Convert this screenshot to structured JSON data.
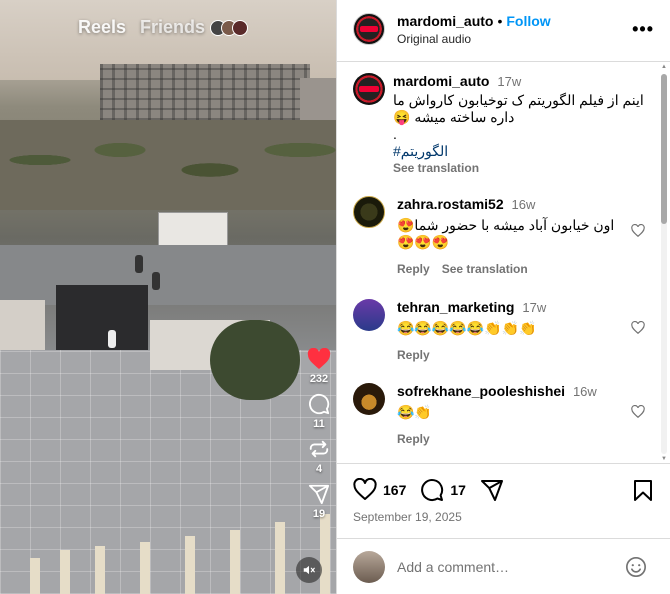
{
  "reel": {
    "tab_reels": "Reels",
    "tab_friends": "Friends",
    "likes_count": "232",
    "comments_count": "11",
    "reposts_count": "4",
    "shares_count": "19",
    "icons": [
      "heart-filled-icon",
      "comment-icon",
      "repost-icon",
      "share-icon",
      "mute-icon"
    ]
  },
  "post": {
    "username": "mardomi_auto",
    "separator": "•",
    "follow_label": "Follow",
    "audio": "Original audio",
    "caption": {
      "username": "mardomi_auto",
      "time": "17w",
      "text_line1": "اینم از فیلم الگوریتم ک توخیابون کارواش ما",
      "text_line2": "داره ساخته میشه 😝",
      "dot": ".",
      "hashtag": "#الگوریتم",
      "see_translation": "See translation"
    },
    "comments": [
      {
        "username": "zahra.rostami52",
        "time": "16w",
        "text": "اون خیابون آباد میشه با حضور شما😍",
        "text2": "😍😍😍",
        "reply": "Reply",
        "see_translation": "See translation"
      },
      {
        "username": "tehran_marketing",
        "time": "17w",
        "text": "😂😂😂😂😂👏👏👏",
        "reply": "Reply"
      },
      {
        "username": "sofrekhane_pooleshishei",
        "time": "16w",
        "text": "😂👏",
        "reply": "Reply"
      }
    ],
    "likes": "167",
    "comment_count": "17",
    "date": "September 19, 2025",
    "add_comment_placeholder": "Add a comment…"
  },
  "colors": {
    "accent": "#0095f6",
    "like_red": "#ff3040",
    "muted_text": "#737373",
    "border": "#dbdbdb"
  }
}
